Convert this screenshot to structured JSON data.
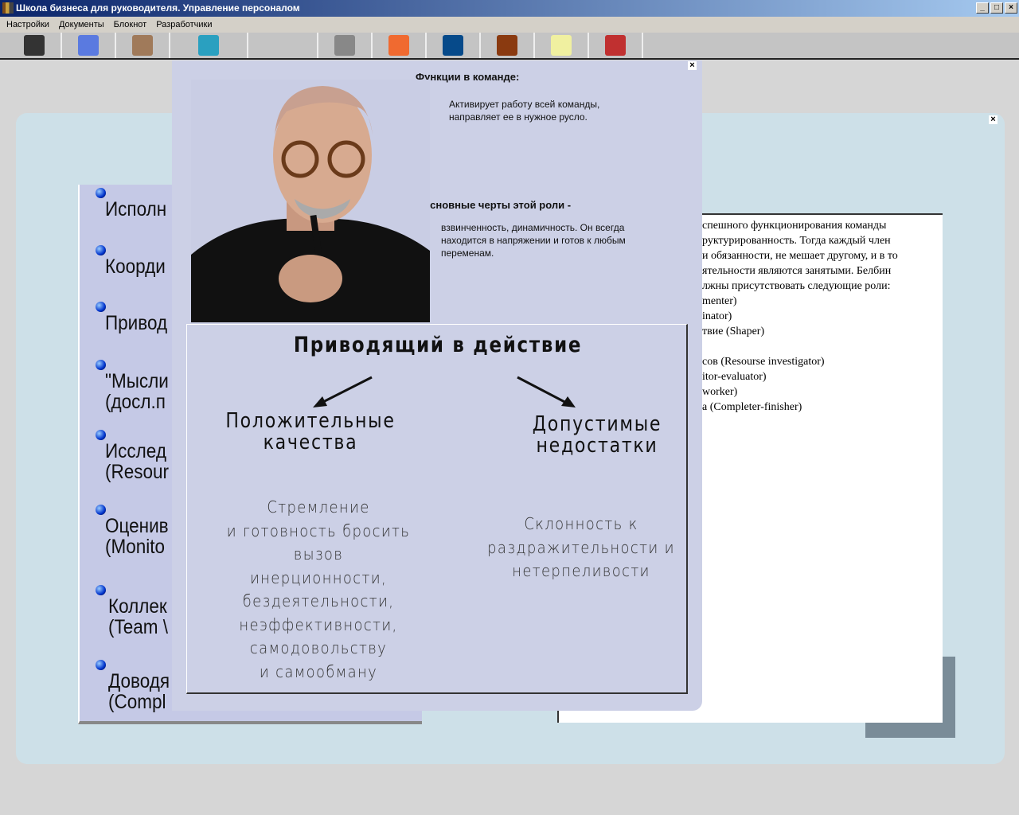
{
  "window": {
    "title": "Школа бизнеса для руководителя. Управление персоналом",
    "min": "_",
    "max": "□",
    "close": "×"
  },
  "menu": [
    "Настройки",
    "Документы",
    "Блокнот",
    "Разработчики"
  ],
  "toolbar": [
    {
      "icon": "phone-icon",
      "color": "#333"
    },
    {
      "icon": "cubes-icon",
      "color": "#5a7ae0"
    },
    {
      "icon": "folders-icon",
      "color": "#a07a5a"
    },
    {
      "icon": "exit-door-icon",
      "color": "#2aa0c0"
    },
    {
      "icon": "blank",
      "color": ""
    },
    {
      "icon": "clipboard-icon",
      "color": "#888"
    },
    {
      "icon": "notebook-icon",
      "color": "#f06a30"
    },
    {
      "icon": "calculator-icon",
      "color": "#064a8a"
    },
    {
      "icon": "books-icon",
      "color": "#8a3a10"
    },
    {
      "icon": "envelope-icon",
      "color": "#f0f0a0"
    },
    {
      "icon": "alphabet-icon",
      "color": "#c03030"
    }
  ],
  "left_list": [
    [
      "Исполн"
    ],
    [
      "Коорди"
    ],
    [
      "Привод"
    ],
    [
      "\"Мысли",
      "(досл.п"
    ],
    [
      "Исслед",
      "(Resour"
    ],
    [
      "Оценив",
      "(Monito"
    ],
    [
      "Коллек",
      "(Team \\"
    ],
    [
      "Доводя",
      "(Compl"
    ]
  ],
  "right_text": [
    "спешного функционирования команды",
    "руктурированность. Тогда каждый член",
    "и обязанности, не мешает другому, и в то",
    "ятельности являются занятыми. Белбин",
    "лжны присутствовать следующие роли:",
    "menter)",
    "inator)",
    "твие (Shaper)",
    "",
    "сов (Resourse investigator)",
    "itor-evaluator)",
    "worker)",
    "а (Completer-finisher)"
  ],
  "popup": {
    "functions_heading": "Функции в команде:",
    "functions_text": [
      "Активирует работу всей команды,",
      "направляет ее в нужное русло."
    ],
    "traits_heading": "Основные черты этой роли -",
    "traits_text": [
      "взвинченность, динамичность. Он всегда",
      "находится в напряжении и готов к любым",
      "переменам."
    ],
    "role_title": "Приводящий в действие",
    "positive_heading": [
      "Положительные",
      "качества"
    ],
    "negative_heading": [
      "Допустимые",
      "недостатки"
    ],
    "positive_text": [
      "Стремление",
      "и готовность бросить вызов",
      "инерционности,",
      "бездеятельности,",
      "неэффективности,",
      "самодовольству",
      "и самообману"
    ],
    "negative_text": [
      "Склонность к",
      "раздражительности и",
      "нетерпеливости"
    ]
  }
}
